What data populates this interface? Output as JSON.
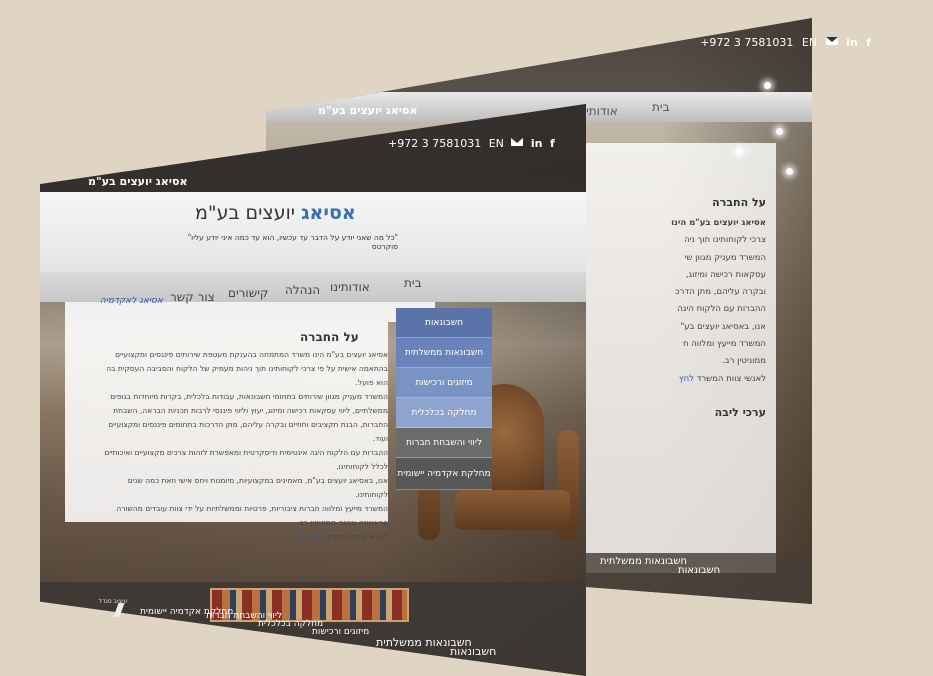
{
  "back": {
    "contact": {
      "phone": "+972 3 7581031",
      "lang": "EN",
      "linkedin": "in",
      "facebook": "f"
    },
    "logo": "אסיאג יועצים בע\"מ",
    "menu": [
      {
        "label": "בית"
      },
      {
        "label": "אודותינו"
      }
    ],
    "panel": {
      "title": "על החברה",
      "lines": [
        "אסיאג יועצים בע\"מ הינו",
        "צרכי לקוחותינו תוך ניה",
        "המשרד מעניק מגוון שי",
        "עסקאות רכישה ומיזוג,",
        "ובקרה עליהם, מתן הדרכ",
        "ההברות עם הלקוח היגה",
        "אנו, באסיאג יועצים בע\"",
        "המשרד מייעץ ומלווה ח",
        "ממוניטין רב."
      ],
      "signoff": "לאנשי צוות המשרד",
      "signoff_link": "לחץ",
      "section2": "ערכי ליבה"
    },
    "bottom": [
      {
        "label": "חשבונאות"
      },
      {
        "label": "חשבונאות ממשלתית"
      }
    ]
  },
  "front": {
    "contact": {
      "phone": "+972 3 7581031",
      "lang": "EN",
      "linkedin": "in",
      "facebook": "f"
    },
    "logo_small": "אסיאג יועצים בע\"מ",
    "logo_brand": "אסיאג",
    "logo_rest": "יועצים בע\"מ",
    "quote": "\"כל מה שאני יודע על הדבר עד עכשיו, הוא עד כמה איני יודע עליו\" סוקרטס",
    "menu": [
      {
        "label": "בית"
      },
      {
        "label": "אודותינו"
      },
      {
        "label": "הנהלה"
      },
      {
        "label": "קישורים"
      },
      {
        "label": "צור קשר"
      }
    ],
    "tagline": "אסיאג לאקדמיה",
    "content": {
      "title": "על החברה",
      "paragraphs": [
        "אסיאג יועצים בע\"מ הינו משרד המתמחה בהענקת מעטפת שירותים פיננסים ומקצועיים בהתאמה אישית על פי צרכי לקוחותינו תוך ניהות מעמיק של הלקוח והסביבה העסקית בה הוא פועל.",
        "המשרד מעניק מגוון שירותים בתחומי חשבונאות, עבודות בלכלית, בקרות מיוחדות בגופים ממשלתיים, ליווי עסקאות רכישה ומיזוג, יעוץ וליווי פיננסי לרבות תכניות הבראה, השבחת החברות, הבנת תקציבים וחוזיים ובקרה עליהם, מתן הדרכות בתחומים פיננסים ומקצועיים ועוד.",
        "ההברות עם הלקוח היגה אינטימית ודיסקרטית ומאפשרת לזהות צרכים מקצועיים ואיכותיים לכלל לקוחותינו.",
        "אנו, באסיאג יועצים בע\"מ, מאמינים במקצועיות, מיומנות ויחס אישי וזאת כמה שנים לקוחותינו.",
        "המשרד מייעץ ומלווה חברות ציבוריות, פרטיות וממשלתיות על ידי צוות עובדים מהשורה הראשונה ונהנה ממוניטין רב."
      ],
      "signoff": "לאנשי צוות המשרד",
      "signoff_link": "לחץ כאן"
    },
    "sidebar": [
      {
        "label": "חשבונאות",
        "color": "#5a73a8"
      },
      {
        "label": "חשבונאות ממשלתית",
        "color": "#6a84bb"
      },
      {
        "label": "מיזוגים ורכישות",
        "color": "#7a93c5"
      },
      {
        "label": "מחלקה בכלכלית",
        "color": "#8ea3cf"
      },
      {
        "label": "ליווי והשבחת חברות",
        "color": "#6b6b6b"
      },
      {
        "label": "מחלקת אקדמיה יישומית",
        "color": "#575757"
      }
    ],
    "footer_row1": [
      "חשבונאות",
      "חשבונאות ממשלתית",
      "מיזוגים ורכישות",
      "מחלקה בכלכלית",
      "ליווי והשבחת חברות",
      "מחלקת אקדמיה יישומית"
    ],
    "footer_small": "עיצוב סנדל"
  }
}
